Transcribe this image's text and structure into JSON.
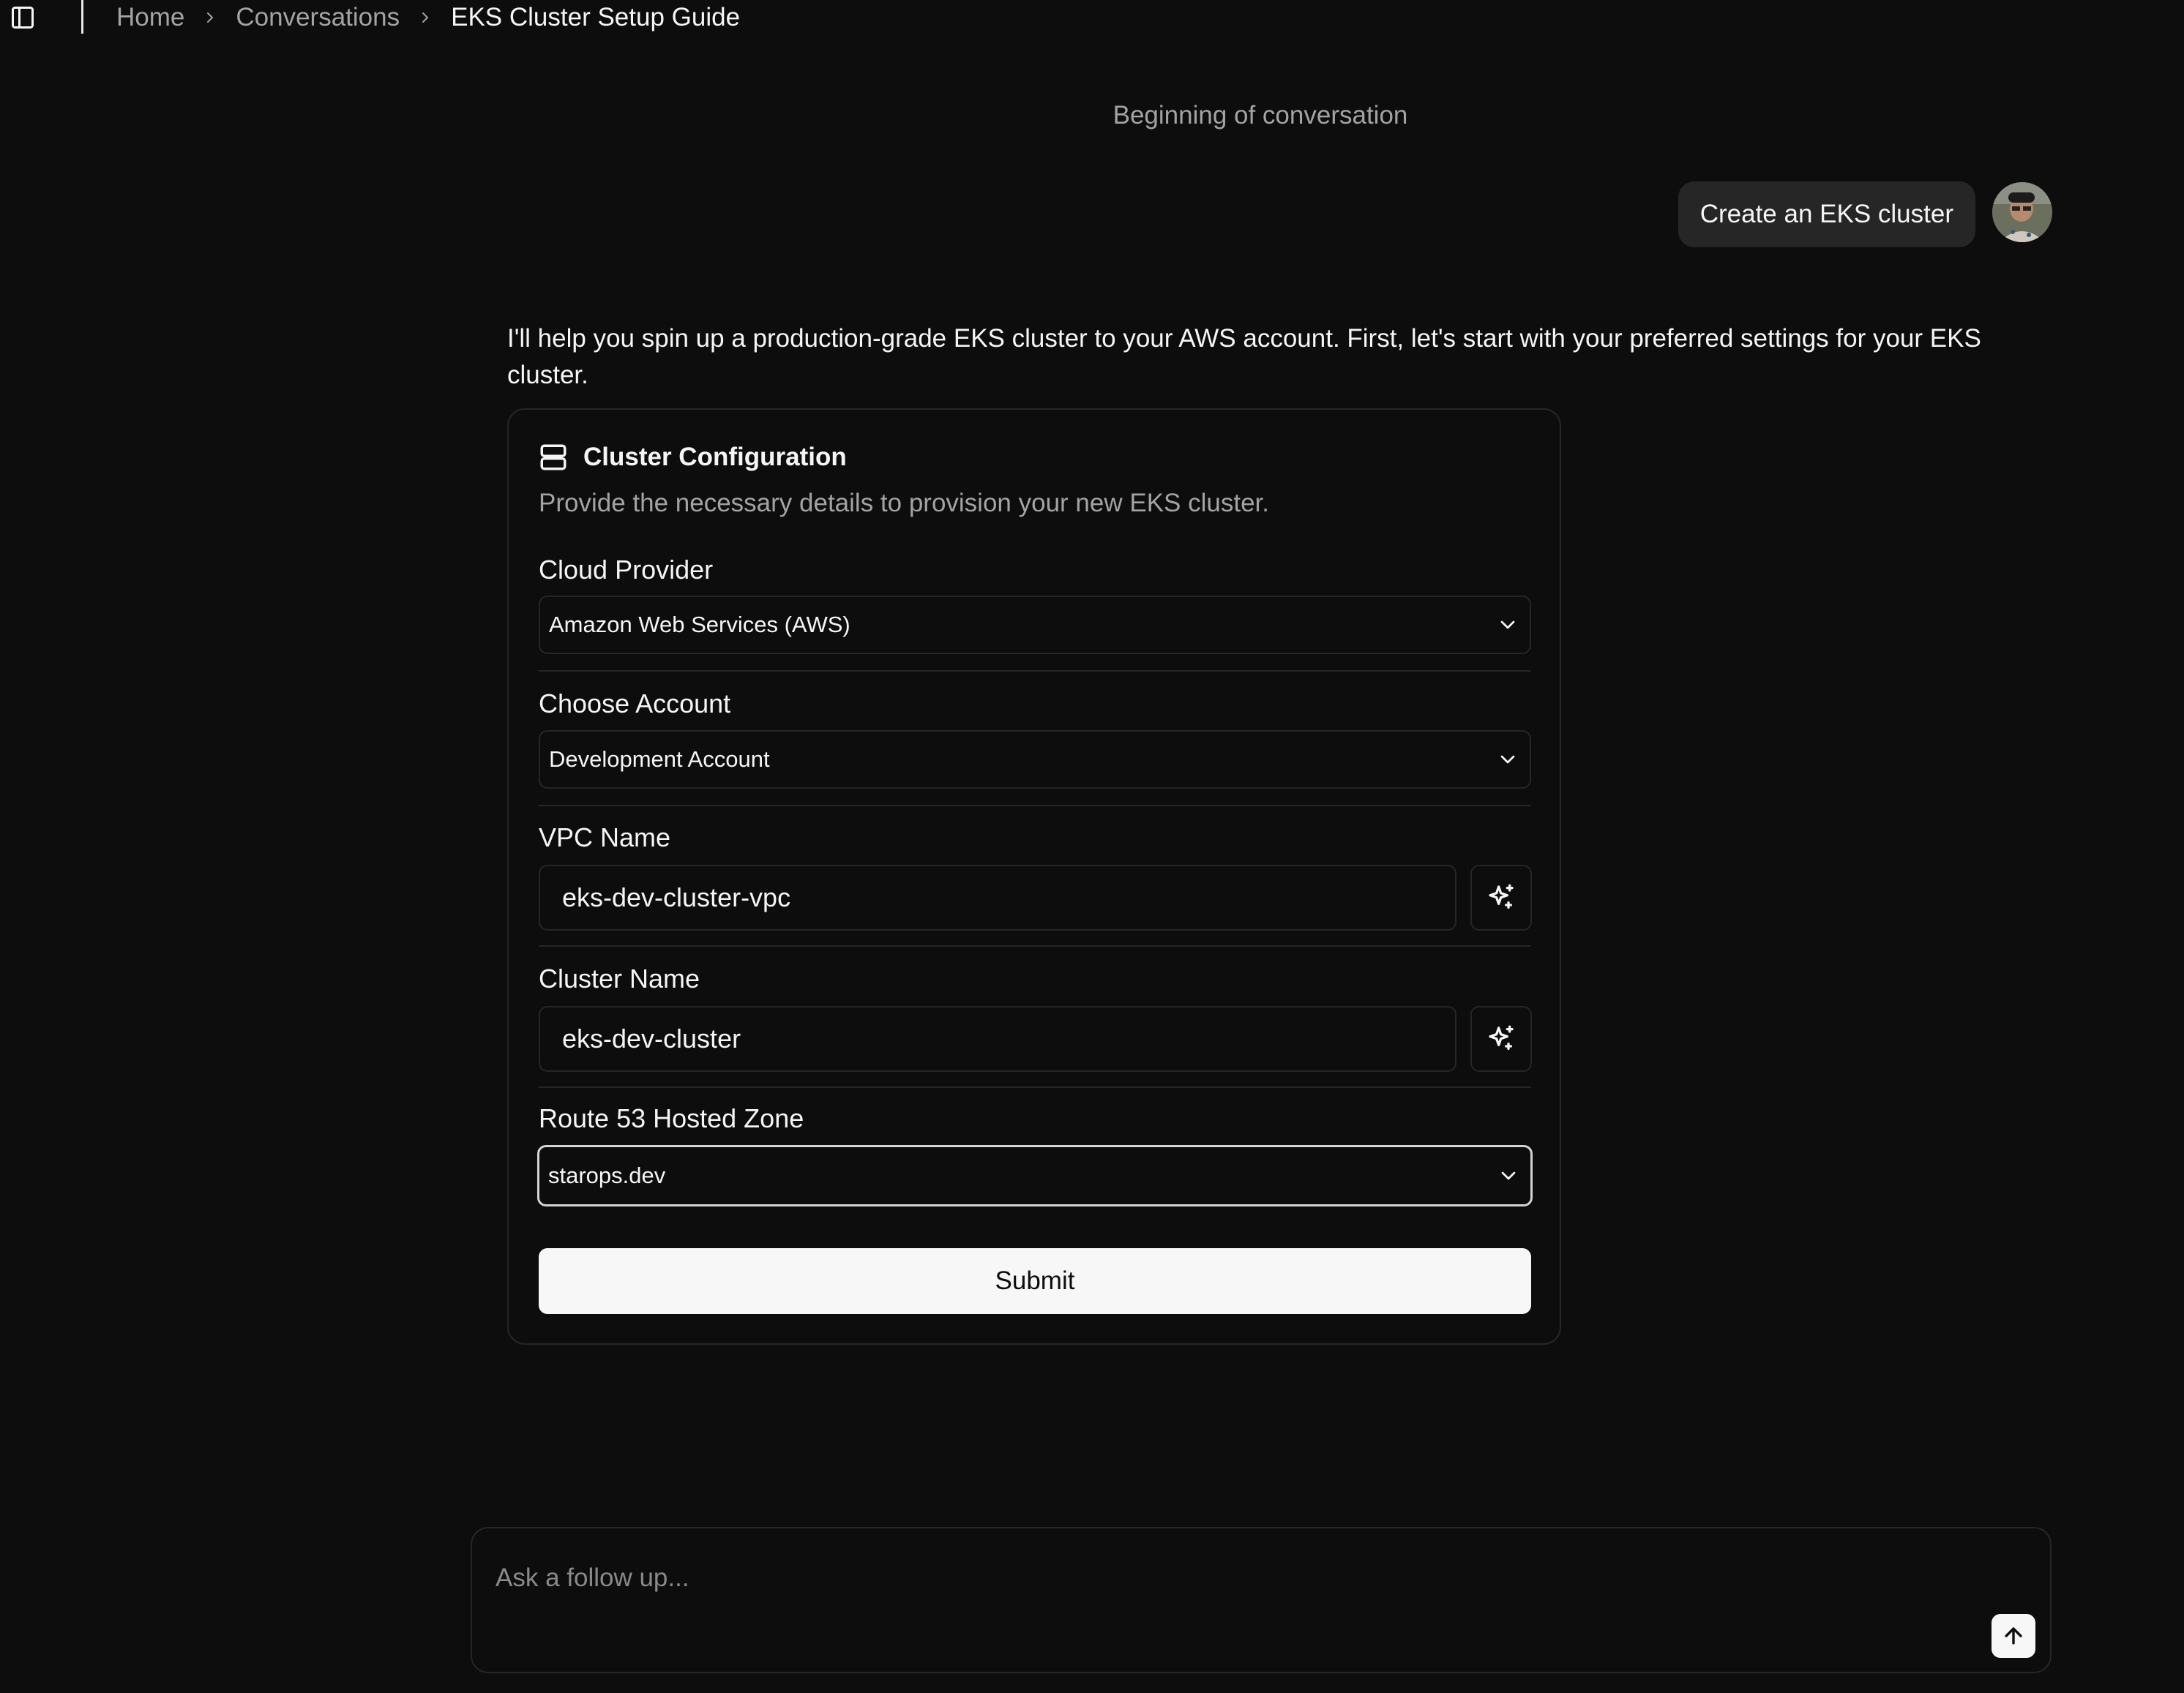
{
  "breadcrumb": {
    "items": [
      "Home",
      "Conversations"
    ],
    "current": "EKS Cluster Setup Guide"
  },
  "conversation": {
    "beginning_label": "Beginning of conversation",
    "user_message": "Create an EKS cluster",
    "assistant_message": "I'll help you spin up a production-grade EKS cluster to your AWS account. First, let's start with your preferred settings for your EKS cluster."
  },
  "card": {
    "title": "Cluster Configuration",
    "description": "Provide the necessary details to provision your new EKS cluster.",
    "fields": {
      "cloud_provider": {
        "label": "Cloud Provider",
        "value": "Amazon Web Services (AWS)"
      },
      "account": {
        "label": "Choose Account",
        "value": "Development Account"
      },
      "vpc_name": {
        "label": "VPC Name",
        "value": "eks-dev-cluster-vpc"
      },
      "cluster_name": {
        "label": "Cluster Name",
        "value": "eks-dev-cluster"
      },
      "hosted_zone": {
        "label": "Route 53 Hosted Zone",
        "value": "starops.dev"
      }
    },
    "submit_label": "Submit"
  },
  "composer": {
    "placeholder": "Ask a follow up..."
  },
  "icons": {
    "sidebar_toggle": "sidebar-toggle-icon",
    "breadcrumb_separator": "chevron-right-icon",
    "card_header": "server-icon",
    "select": "chevron-down-icon",
    "generate": "sparkles-icon",
    "send": "arrow-up-icon"
  },
  "colors": {
    "background": "#0d0d0d",
    "border": "#262626",
    "text": "#f5f5f5",
    "muted_text": "#a3a3a3",
    "button_bg": "#f7f7f7"
  }
}
